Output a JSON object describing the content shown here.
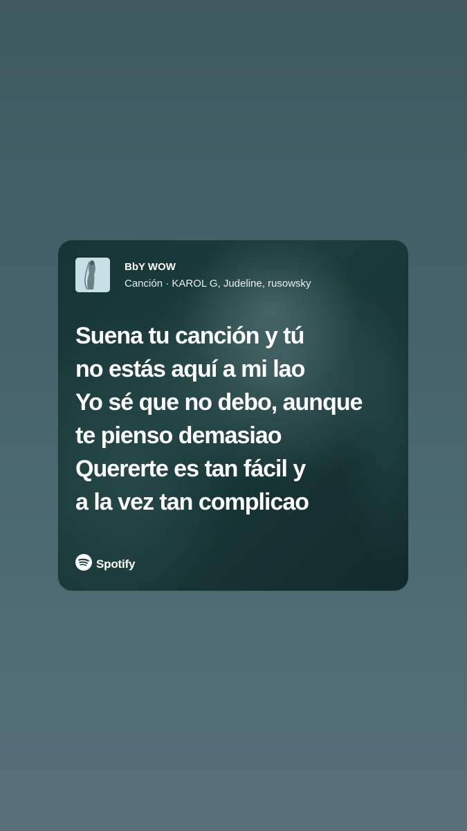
{
  "track": {
    "title": "BbY WOW",
    "subtitle": "Canción · KAROL G, Judeline, rusowsky"
  },
  "lyrics": [
    "Suena tu canción y tú",
    "no estás aquí a mi lao",
    "Yo sé que no debo, aunque",
    "te pienso demasiao",
    "Quererte es tan fácil y",
    "a la vez tan complicao"
  ],
  "brand": {
    "name": "Spotify",
    "icon": "spotify-logo-icon"
  }
}
